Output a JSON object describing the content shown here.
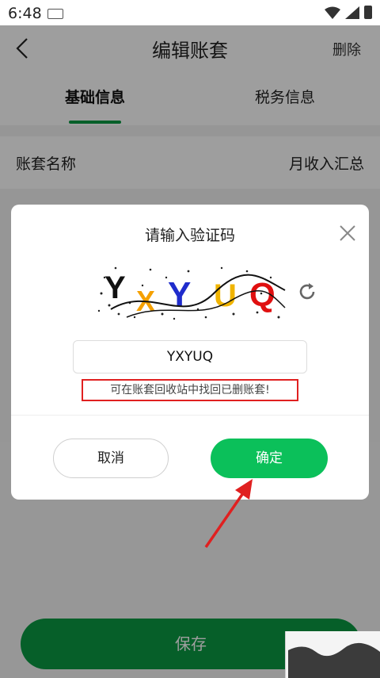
{
  "status_bar": {
    "time": "6:48"
  },
  "header": {
    "title": "编辑账套",
    "delete_label": "删除"
  },
  "tabs": [
    {
      "label": "基础信息",
      "active": true
    },
    {
      "label": "税务信息",
      "active": false
    }
  ],
  "form": {
    "rows": [
      {
        "label": "账套名称",
        "value": "月收入汇总"
      }
    ]
  },
  "save_label": "保存",
  "dialog": {
    "title": "请输入验证码",
    "captcha_input_value": "YXYUQ",
    "hint": "可在账套回收站中找回已删账套!",
    "cancel_label": "取消",
    "confirm_label": "确定"
  },
  "colors": {
    "brand_green": "#0a9a43",
    "confirm_green": "#0bc05a",
    "annotation_red": "#e02020"
  }
}
